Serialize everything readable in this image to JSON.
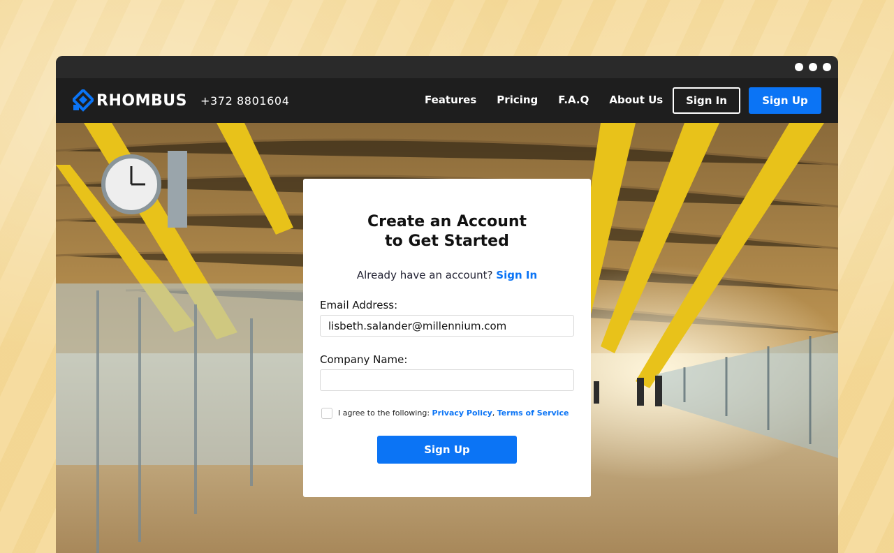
{
  "brand": {
    "name": "RHOMBUS",
    "phone": "+372 8801604"
  },
  "nav": {
    "links": [
      "Features",
      "Pricing",
      "F.A.Q",
      "About Us"
    ],
    "sign_in": "Sign In",
    "sign_up": "Sign Up"
  },
  "form": {
    "title_line1": "Create an Account",
    "title_line2": "to Get Started",
    "already_text": "Already have an account?",
    "already_link": "Sign In",
    "email_label": "Email Address:",
    "email_value": "lisbeth.salander@millennium.com",
    "company_label": "Company Name:",
    "company_value": "",
    "agree_text": "I agree to the following:",
    "privacy_link": "Privacy Policy",
    "separator": ",",
    "terms_link": "Terms of Service",
    "submit": "Sign Up"
  },
  "colors": {
    "accent": "#0b74f5",
    "navbar": "#1e1e1e",
    "page_background": "#f6dca0"
  },
  "icons": {
    "logo": "rhombus-logo-icon"
  }
}
